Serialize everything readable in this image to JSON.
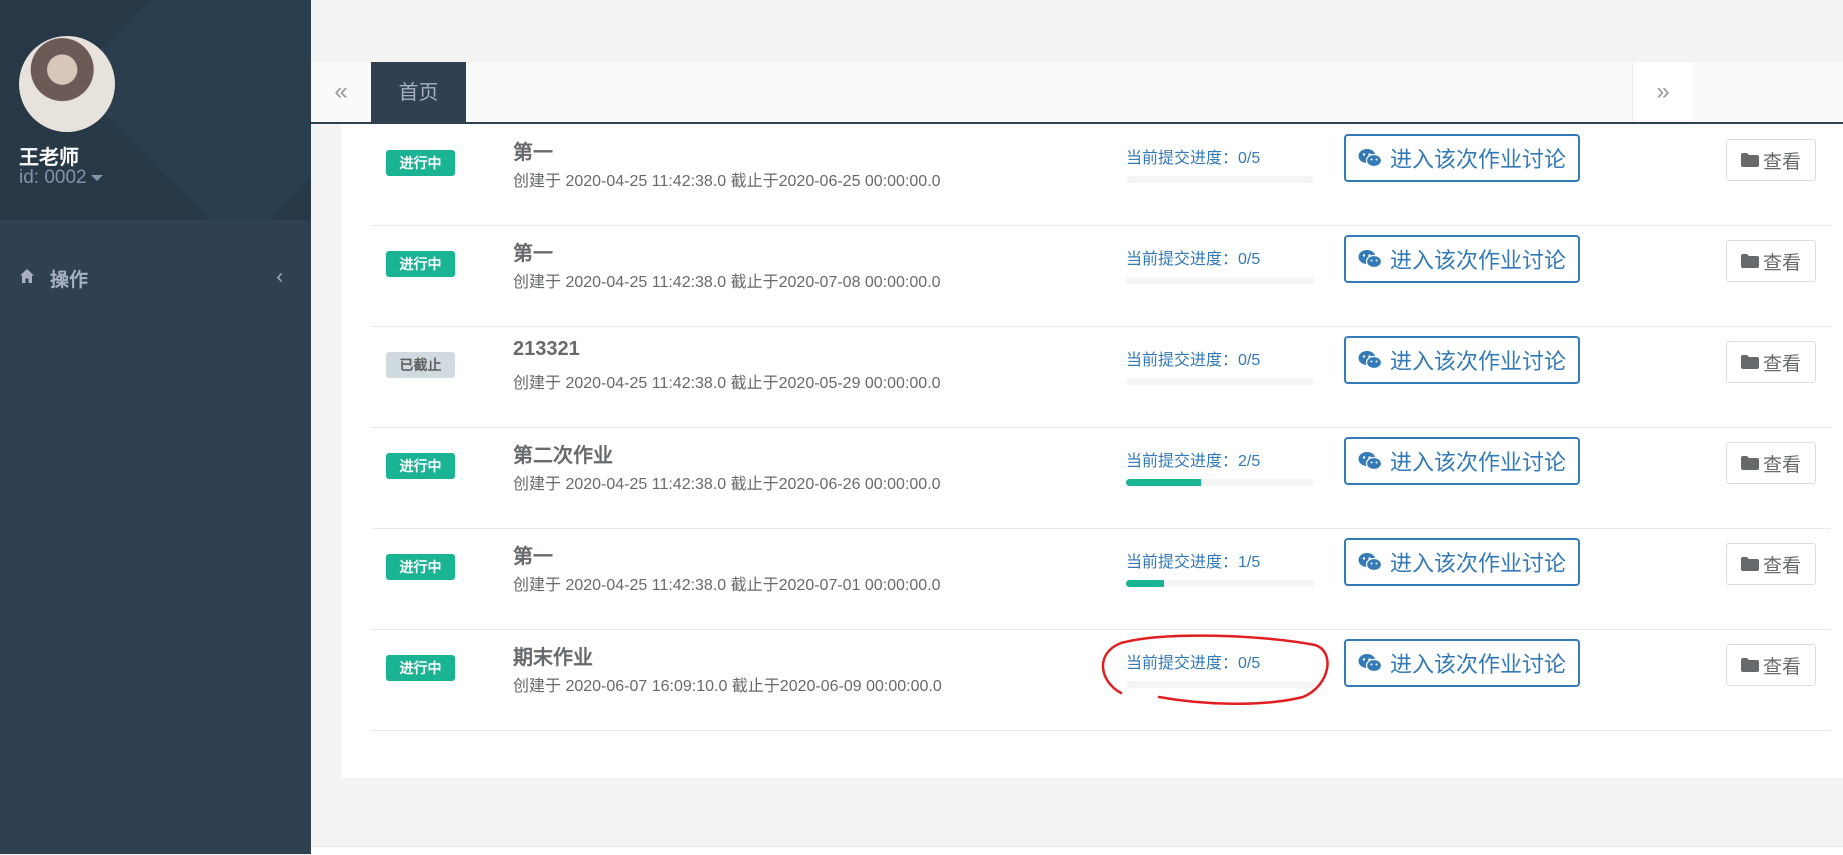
{
  "sidebar": {
    "teacher_name": "王老师",
    "teacher_id": "id: 0002",
    "nav": {
      "label": "操作",
      "chevron": "‹"
    }
  },
  "tabs": {
    "prev": "«",
    "home": "首页",
    "next": "»"
  },
  "homework": [
    {
      "status": "进行中",
      "status_type": "ongoing",
      "title": "第一",
      "meta": "创建于 2020-04-25 11:42:38.0 截止于2020-06-25 00:00:00.0",
      "progress_label": "当前提交进度：0/5",
      "progress": 0,
      "discuss_label": "进入该次作业讨论",
      "view_label": "查看"
    },
    {
      "status": "进行中",
      "status_type": "ongoing",
      "title": "第一",
      "meta": "创建于 2020-04-25 11:42:38.0 截止于2020-07-08 00:00:00.0",
      "progress_label": "当前提交进度：0/5",
      "progress": 0,
      "discuss_label": "进入该次作业讨论",
      "view_label": "查看"
    },
    {
      "status": "已截止",
      "status_type": "closed",
      "title": "213321",
      "meta": "创建于 2020-04-25 11:42:38.0 截止于2020-05-29 00:00:00.0",
      "progress_label": "当前提交进度：0/5",
      "progress": 0,
      "discuss_label": "进入该次作业讨论",
      "view_label": "查看"
    },
    {
      "status": "进行中",
      "status_type": "ongoing",
      "title": "第二次作业",
      "meta": "创建于 2020-04-25 11:42:38.0 截止于2020-06-26 00:00:00.0",
      "progress_label": "当前提交进度：2/5",
      "progress": 0.4,
      "discuss_label": "进入该次作业讨论",
      "view_label": "查看"
    },
    {
      "status": "进行中",
      "status_type": "ongoing",
      "title": "第一",
      "meta": "创建于 2020-04-25 11:42:38.0 截止于2020-07-01 00:00:00.0",
      "progress_label": "当前提交进度：1/5",
      "progress": 0.2,
      "discuss_label": "进入该次作业讨论",
      "view_label": "查看"
    },
    {
      "status": "进行中",
      "status_type": "ongoing",
      "title": "期末作业",
      "meta": "创建于 2020-06-07 16:09:10.0 截止于2020-06-09 00:00:00.0",
      "progress_label": "当前提交进度：0/5",
      "progress": 0,
      "discuss_label": "进入该次作业讨论",
      "view_label": "查看"
    }
  ],
  "colors": {
    "sidebar": "#2f4050",
    "ongoing": "#1ab394",
    "closed": "#d1dade",
    "link": "#337ab7",
    "annotation": "#e02020"
  },
  "icons": {
    "home": "home-icon",
    "discuss": "wechat-icon",
    "view": "folder-icon"
  }
}
